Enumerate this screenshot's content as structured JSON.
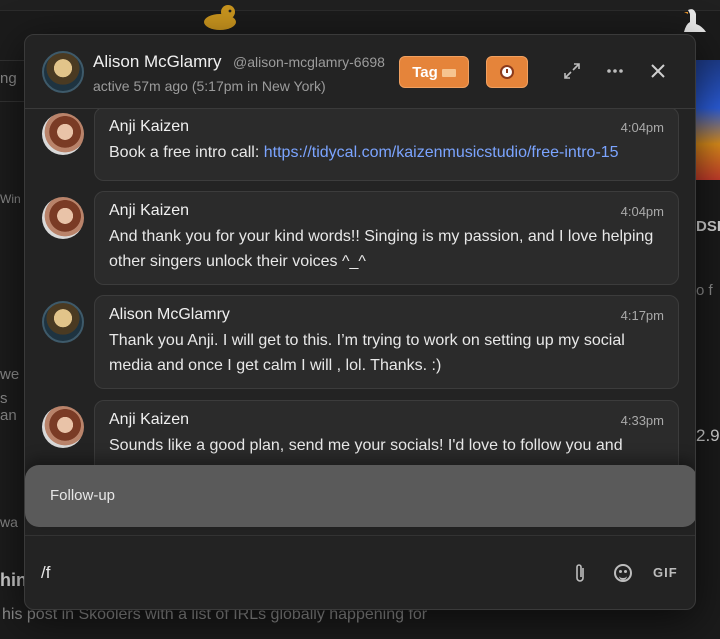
{
  "header": {
    "name": "Alison McGlamry",
    "handle": "@alison-mcglamry-6698",
    "status": "active 57m ago (5:17pm in New York)",
    "tag_label": "Tag"
  },
  "messages": [
    {
      "author": "Anji Kaizen",
      "time": "4:04pm",
      "text": "Book a free intro call: ",
      "link": "https://tidycal.com/kaizenmusicstudio/free-intro-15"
    },
    {
      "author": "Anji Kaizen",
      "time": "4:04pm",
      "text": "And thank you for your kind words!! Singing is my passion, and I love helping other singers unlock their voices ^_^"
    },
    {
      "author": "Alison McGlamry",
      "time": "4:17pm",
      "text": "Thank you Anji. I will get to this. I’m trying to work on setting up my social media and once I get calm I will , lol. Thanks. :)"
    },
    {
      "author": "Anji Kaizen",
      "time": "4:33pm",
      "text": "Sounds like a good plan, send me your socials! I'd love to follow you and"
    }
  ],
  "suggestion": {
    "label": "Follow-up"
  },
  "composer": {
    "value": "/f",
    "gif_label": "GIF"
  },
  "background": {
    "left_fragments": [
      "ng",
      "Win",
      "we",
      "s an",
      "wa",
      "hin"
    ],
    "right_fragments": [
      "DSI",
      "o f",
      "2.9"
    ],
    "bottom_text": "his post in Skoolers with a list of IRLs globally happening for"
  },
  "colors": {
    "accent": "#e5843a",
    "link": "#7ba4ff",
    "modal_bg": "#232323",
    "bubble_bg": "#2b2b2b"
  }
}
